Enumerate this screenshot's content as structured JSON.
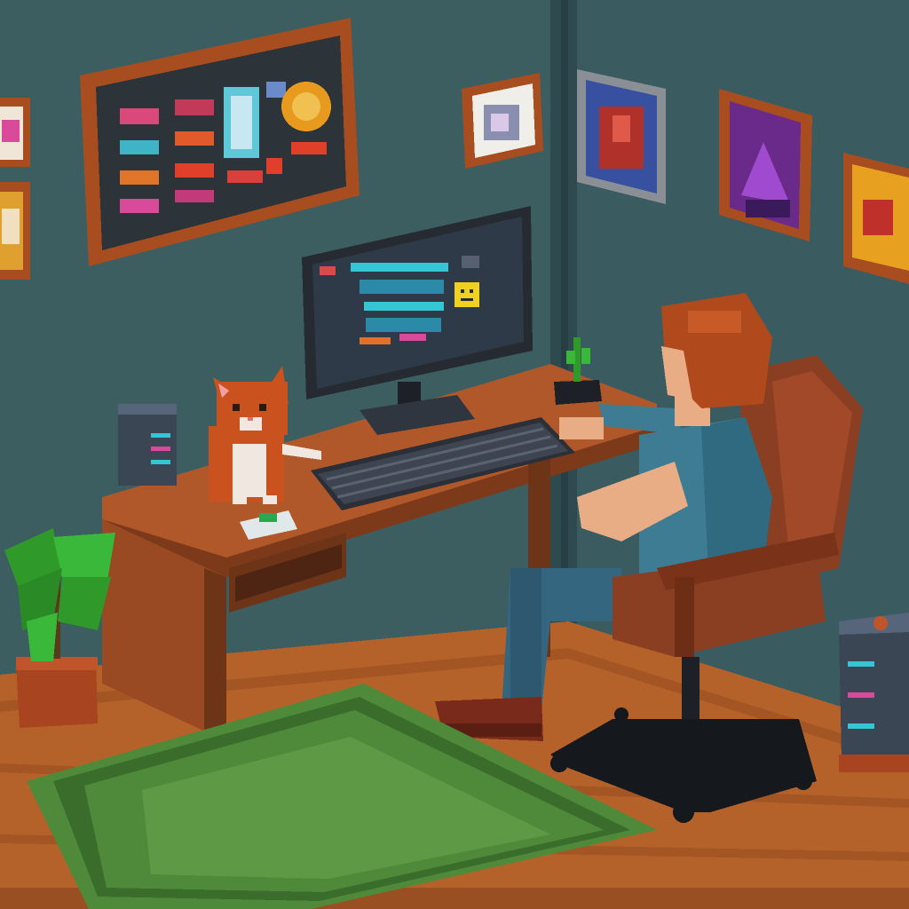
{
  "scene": {
    "type": "pixel-art room",
    "colors": {
      "wall_left": "#3c5e61",
      "wall_right": "#3a5b60",
      "corner_shadow": "#2e4a4f",
      "floor": "#b5612a",
      "floor_dark": "#8f4a1f",
      "desk": "#b1582a",
      "desk_dark": "#7c3a1b",
      "rug": "#4f8a3a",
      "rug_dark": "#3a6d2c",
      "chair": "#8a3e22",
      "shirt": "#3d7c93",
      "jeans": "#35667f",
      "hair": "#b04a1c",
      "skin": "#e8ad85",
      "cat": "#c9521e",
      "monitor_bezel": "#262b31",
      "monitor_screen": "#2f3a48",
      "screen_accent": "#35c6d6",
      "plant": "#2f9a2a",
      "pot": "#a8441f",
      "frame": "#a84d1f",
      "pc_tower": "#3a4654"
    },
    "icons": [
      "bulletin-board-icon",
      "poster-icon",
      "monitor-icon",
      "smiley-icon",
      "cat-icon",
      "keyboard-icon",
      "person-icon",
      "office-chair-icon",
      "potted-plant-icon",
      "pc-tower-icon",
      "small-plant-icon",
      "rug-icon"
    ]
  }
}
